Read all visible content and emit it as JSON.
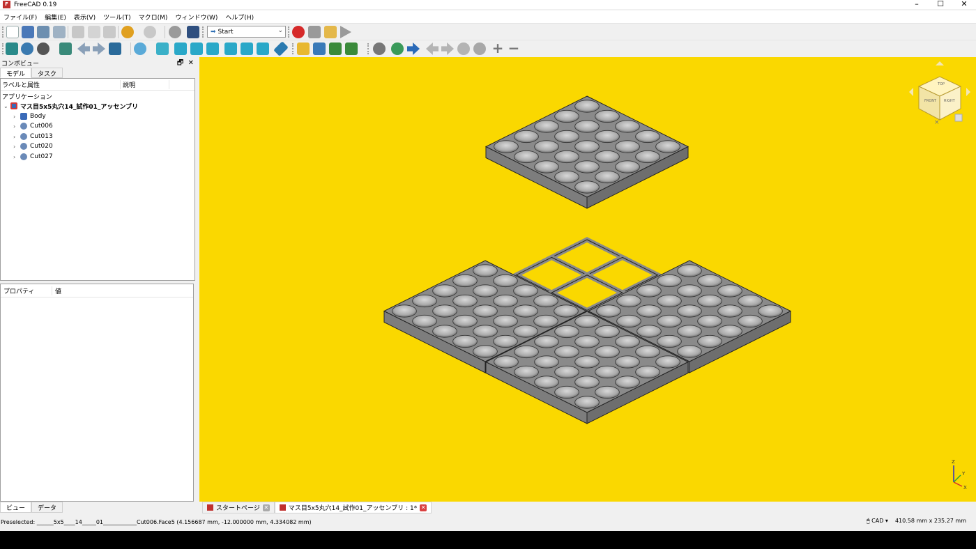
{
  "window": {
    "title": "FreeCAD 0.19",
    "icon": "freecad-logo"
  },
  "menu": [
    "ファイル(F)",
    "編集(E)",
    "表示(V)",
    "ツール(T)",
    "マクロ(M)",
    "ウィンドウ(W)",
    "ヘルプ(H)"
  ],
  "toolbar": {
    "workbench": "Start"
  },
  "combo": {
    "title": "コンボビュー",
    "tabs": [
      "モデル",
      "タスク"
    ],
    "tree_headers": [
      "ラベルと属性",
      "説明"
    ],
    "application_label": "アプリケーション",
    "document": "マス目5x5丸穴14_試作01_アッセンブリ",
    "items": [
      "Body",
      "Cut006",
      "Cut013",
      "Cut020",
      "Cut027"
    ],
    "prop_headers": [
      "プロパティ",
      "値"
    ],
    "bottom_tabs": [
      "ビュー",
      "データ"
    ]
  },
  "doc_tabs": [
    "スタートページ",
    "マス目5x5丸穴14_試作01_アッセンブリ : 1*"
  ],
  "status": {
    "preselected": "Preselected: ______5x5____14_____01____________Cut006.Face5 (4.156687 mm, -12.000000 mm, 4.334082 mm)",
    "nav_style": "CAD",
    "dimensions": "410.58 mm x 235.27 mm"
  },
  "colors": {
    "viewport_bg": "#fad800",
    "part": "#8a8a8a",
    "accent_red": "#d62a2a"
  }
}
